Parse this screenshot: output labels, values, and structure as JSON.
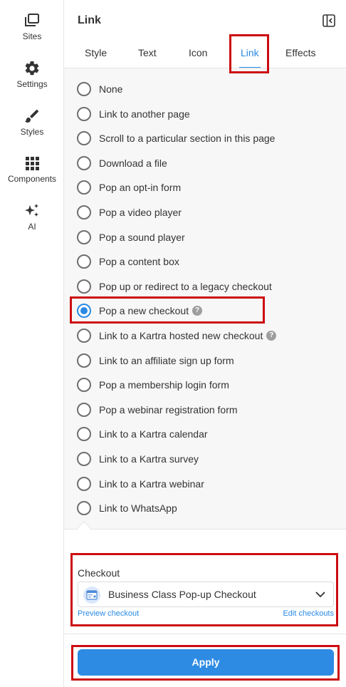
{
  "sidebar": {
    "items": [
      {
        "label": "Sites",
        "icon": "sites-icon"
      },
      {
        "label": "Settings",
        "icon": "gear-icon"
      },
      {
        "label": "Styles",
        "icon": "brush-icon"
      },
      {
        "label": "Components",
        "icon": "grid-icon"
      },
      {
        "label": "AI",
        "icon": "sparkle-icon"
      }
    ]
  },
  "panel": {
    "title": "Link",
    "tabs": [
      {
        "label": "Style"
      },
      {
        "label": "Text"
      },
      {
        "label": "Icon"
      },
      {
        "label": "Link"
      },
      {
        "label": "Effects"
      }
    ],
    "active_tab": "Link",
    "options": [
      {
        "label": "None"
      },
      {
        "label": "Link to another page"
      },
      {
        "label": "Scroll to a particular section in this page"
      },
      {
        "label": "Download a file"
      },
      {
        "label": "Pop an opt-in form"
      },
      {
        "label": "Pop a video player"
      },
      {
        "label": "Pop a sound player"
      },
      {
        "label": "Pop a content box"
      },
      {
        "label": "Pop up or redirect to a legacy checkout"
      },
      {
        "label": "Pop a new checkout"
      },
      {
        "label": "Link to a Kartra hosted new checkout"
      },
      {
        "label": "Link to an affiliate sign up form"
      },
      {
        "label": "Pop a membership login form"
      },
      {
        "label": "Pop a webinar registration form"
      },
      {
        "label": "Link to a Kartra calendar"
      },
      {
        "label": "Link to a Kartra survey"
      },
      {
        "label": "Link to a Kartra webinar"
      },
      {
        "label": "Link to WhatsApp"
      }
    ],
    "selected_option": "Pop a new checkout",
    "checkout": {
      "label": "Checkout",
      "selected": "Business Class Pop-up Checkout",
      "preview_link": "Preview checkout",
      "edit_link": "Edit checkouts"
    },
    "apply_label": "Apply"
  },
  "colors": {
    "accent": "#2a8ae4",
    "highlight": "#cc0c10",
    "options_bg": "#f7f7f7"
  }
}
